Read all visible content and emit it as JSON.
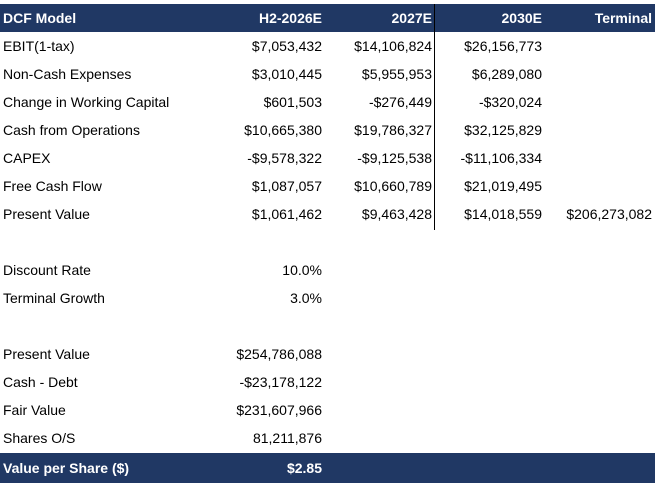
{
  "header": {
    "title": "DCF Model",
    "columns": [
      "H2-2026E",
      "2027E",
      "2030E",
      "Terminal"
    ]
  },
  "rows": [
    {
      "label": "EBIT(1-tax)",
      "values": [
        "$7,053,432",
        "$14,106,824",
        "$26,156,773",
        ""
      ]
    },
    {
      "label": "Non-Cash Expenses",
      "values": [
        "$3,010,445",
        "$5,955,953",
        "$6,289,080",
        ""
      ]
    },
    {
      "label": "Change in Working Capital",
      "values": [
        "$601,503",
        "-$276,449",
        "-$320,024",
        ""
      ]
    },
    {
      "label": "Cash from Operations",
      "values": [
        "$10,665,380",
        "$19,786,327",
        "$32,125,829",
        ""
      ]
    },
    {
      "label": "CAPEX",
      "values": [
        "-$9,578,322",
        "-$9,125,538",
        "-$11,106,334",
        ""
      ]
    },
    {
      "label": "Free Cash Flow",
      "values": [
        "$1,087,057",
        "$10,660,789",
        "$21,019,495",
        ""
      ]
    },
    {
      "label": "Present Value",
      "values": [
        "$1,061,462",
        "$9,463,428",
        "$14,018,559",
        "$206,273,082"
      ]
    }
  ],
  "assumptions": [
    {
      "label": "Discount Rate",
      "value": "10.0%"
    },
    {
      "label": "Terminal Growth",
      "value": "3.0%"
    }
  ],
  "valuation": [
    {
      "label": "Present Value",
      "value": "$254,786,088"
    },
    {
      "label": "Cash - Debt",
      "value": "-$23,178,122"
    },
    {
      "label": "Fair Value",
      "value": "$231,607,966"
    },
    {
      "label": "Shares O/S",
      "value": "81,211,876"
    }
  ],
  "footer": {
    "label": "Value per Share ($)",
    "value": "$2.85"
  },
  "colors": {
    "header_bg": "#203864",
    "header_text": "#ffffff"
  }
}
